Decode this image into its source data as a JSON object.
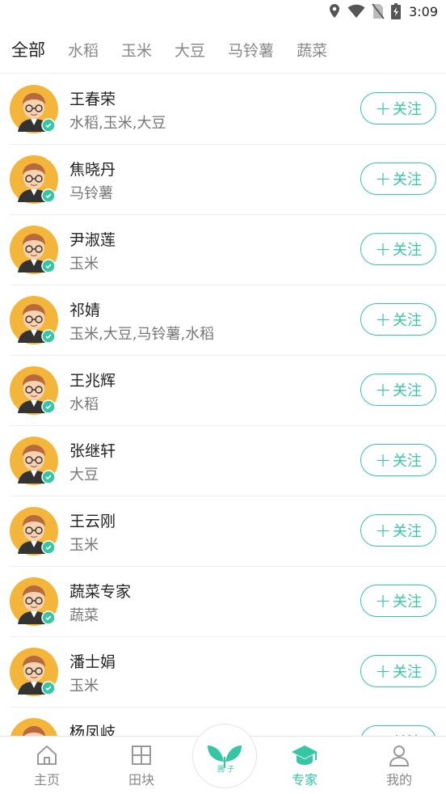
{
  "status_bar": {
    "time": "3:09",
    "icons": [
      "location-icon",
      "wifi-icon",
      "no-sim-icon",
      "battery-charging-icon"
    ]
  },
  "tabs": [
    {
      "label": "全部",
      "active": true
    },
    {
      "label": "水稻",
      "active": false
    },
    {
      "label": "玉米",
      "active": false
    },
    {
      "label": "大豆",
      "active": false
    },
    {
      "label": "马铃薯",
      "active": false
    },
    {
      "label": "蔬菜",
      "active": false
    }
  ],
  "follow_label": "关注",
  "experts": [
    {
      "name": "王春荣",
      "crops": "水稻,玉米,大豆"
    },
    {
      "name": "焦晓丹",
      "crops": "马铃薯"
    },
    {
      "name": "尹淑莲",
      "crops": "玉米"
    },
    {
      "name": "祁婧",
      "crops": "玉米,大豆,马铃薯,水稻"
    },
    {
      "name": "王兆辉",
      "crops": "水稻"
    },
    {
      "name": "张继轩",
      "crops": "大豆"
    },
    {
      "name": "王云刚",
      "crops": "玉米"
    },
    {
      "name": "蔬菜专家",
      "crops": "蔬菜"
    },
    {
      "name": "潘士娟",
      "crops": "玉米"
    },
    {
      "name": "杨凤岐",
      "crops": ""
    }
  ],
  "bottom_nav": {
    "items": [
      {
        "label": "主页",
        "icon": "home-icon",
        "active": false
      },
      {
        "label": "田块",
        "icon": "field-icon",
        "active": false
      },
      {
        "label": "专家",
        "icon": "expert-cap-icon",
        "active": true
      },
      {
        "label": "我的",
        "icon": "user-icon",
        "active": false
      }
    ],
    "center_icon": "sprout-logo-icon"
  },
  "colors": {
    "accent": "#35c6a4",
    "avatar_bg": "#f3b63a"
  }
}
